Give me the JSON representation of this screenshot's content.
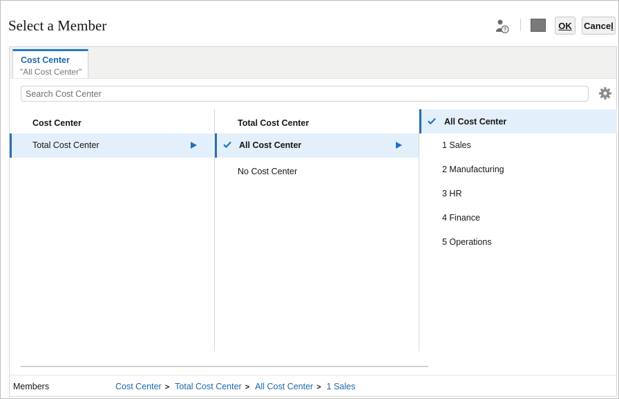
{
  "dialog": {
    "title": "Select a Member",
    "ok_label": "OK",
    "cancel_label_main": "Cance",
    "cancel_label_ul": "l"
  },
  "tabs": [
    {
      "label": "Cost Center",
      "value": "\"All Cost Center\""
    }
  ],
  "search": {
    "placeholder": "Search Cost Center",
    "value": ""
  },
  "columns": [
    {
      "header": "Cost Center",
      "items": [
        {
          "label": "Total Cost Center",
          "selected": true,
          "checked": false,
          "has_children": true
        }
      ]
    },
    {
      "header": "Total Cost Center",
      "items": [
        {
          "label": "All Cost Center",
          "selected": true,
          "checked": true,
          "has_children": true
        },
        {
          "label": "No Cost Center",
          "selected": false,
          "checked": false,
          "has_children": false
        }
      ]
    },
    {
      "header": "All Cost Center",
      "header_checked": true,
      "items": [
        {
          "label": "1 Sales"
        },
        {
          "label": "2 Manufacturing"
        },
        {
          "label": "3 HR"
        },
        {
          "label": "4 Finance"
        },
        {
          "label": "5 Operations"
        }
      ]
    }
  ],
  "footer": {
    "label": "Members",
    "breadcrumb": [
      "Cost Center",
      "Total Cost Center",
      "All Cost Center",
      "1 Sales"
    ],
    "separator": ">"
  },
  "icons": {
    "user": "user-help-icon",
    "square": "square-icon",
    "gear": "gear-icon",
    "check": "checkmark-icon",
    "arrow": "expand-arrow-icon"
  },
  "colors": {
    "accent": "#1b67ab",
    "selection": "#e3effb",
    "selection_bar": "#2d6fb1",
    "arrow": "#1a72c2"
  }
}
